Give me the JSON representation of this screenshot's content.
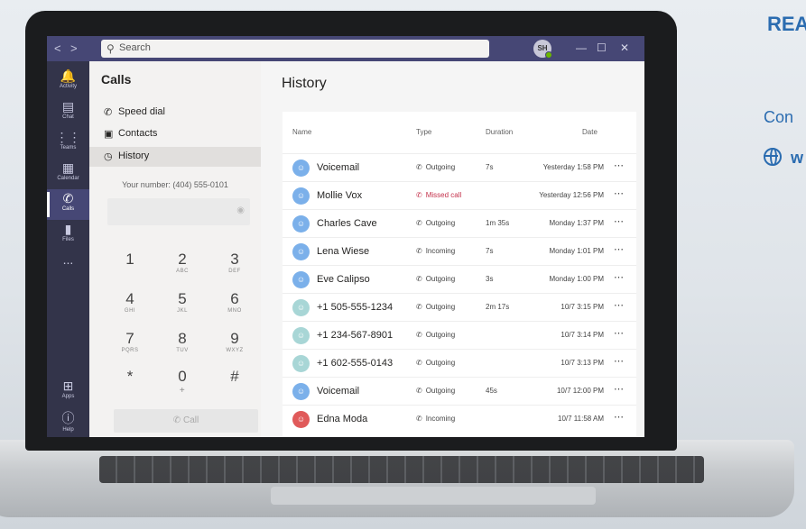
{
  "background": {
    "title": "REA",
    "subtitle": "Con",
    "website": "w"
  },
  "teams": {
    "search_placeholder": "Search",
    "user_initials": "SH",
    "rail": [
      {
        "label": "Activity",
        "icon": "bell-icon"
      },
      {
        "label": "Chat",
        "icon": "chat-icon"
      },
      {
        "label": "Teams",
        "icon": "teams-icon"
      },
      {
        "label": "Calendar",
        "icon": "calendar-icon"
      },
      {
        "label": "Calls",
        "icon": "phone-icon"
      },
      {
        "label": "Files",
        "icon": "file-icon"
      },
      {
        "label": "...",
        "icon": "more-icon"
      },
      {
        "label": "Apps",
        "icon": "apps-icon"
      },
      {
        "label": "Help",
        "icon": "help-icon"
      }
    ],
    "calls_panel": {
      "title": "Calls",
      "menu": [
        "Speed dial",
        "Contacts",
        "History"
      ],
      "your_number": "Your number: (404) 555-0101",
      "call_button": "Call"
    },
    "dialpad": [
      {
        "digit": "1",
        "letters": ""
      },
      {
        "digit": "2",
        "letters": "ABC"
      },
      {
        "digit": "3",
        "letters": "DEF"
      },
      {
        "digit": "4",
        "letters": "GHI"
      },
      {
        "digit": "5",
        "letters": "JKL"
      },
      {
        "digit": "6",
        "letters": "MNO"
      },
      {
        "digit": "7",
        "letters": "PQRS"
      },
      {
        "digit": "8",
        "letters": "TUV"
      },
      {
        "digit": "9",
        "letters": "WXYZ"
      },
      {
        "digit": "*",
        "letters": ""
      },
      {
        "digit": "0",
        "letters": "+"
      },
      {
        "digit": "#",
        "letters": ""
      }
    ],
    "history": {
      "title": "History",
      "headers": {
        "name": "Name",
        "type": "Type",
        "duration": "Duration",
        "date": "Date"
      },
      "rows": [
        {
          "name": "Voicemail",
          "type": "Outgoing",
          "duration": "7s",
          "date": "Yesterday 1:58 PM",
          "missed": false,
          "avatar": "blue"
        },
        {
          "name": "Mollie Vox",
          "type": "Missed call",
          "duration": "",
          "date": "Yesterday 12:56 PM",
          "missed": true,
          "avatar": "blue"
        },
        {
          "name": "Charles Cave",
          "type": "Outgoing",
          "duration": "1m 35s",
          "date": "Monday 1:37 PM",
          "missed": false,
          "avatar": "blue"
        },
        {
          "name": "Lena Wiese",
          "type": "Incoming",
          "duration": "7s",
          "date": "Monday 1:01 PM",
          "missed": false,
          "avatar": "blue"
        },
        {
          "name": "Eve Calipso",
          "type": "Outgoing",
          "duration": "3s",
          "date": "Monday 1:00 PM",
          "missed": false,
          "avatar": "blue"
        },
        {
          "name": "+1 505-555-1234",
          "type": "Outgoing",
          "duration": "2m 17s",
          "date": "10/7 3:15 PM",
          "missed": false,
          "avatar": "light"
        },
        {
          "name": "+1 234-567-8901",
          "type": "Outgoing",
          "duration": "",
          "date": "10/7 3:14 PM",
          "missed": false,
          "avatar": "light"
        },
        {
          "name": "+1 602-555-0143",
          "type": "Outgoing",
          "duration": "",
          "date": "10/7 3:13 PM",
          "missed": false,
          "avatar": "light"
        },
        {
          "name": "Voicemail",
          "type": "Outgoing",
          "duration": "45s",
          "date": "10/7 12:00 PM",
          "missed": false,
          "avatar": "blue"
        },
        {
          "name": "Edna Moda",
          "type": "Incoming",
          "duration": "",
          "date": "10/7 11:58 AM",
          "missed": false,
          "avatar": "red"
        }
      ]
    }
  }
}
